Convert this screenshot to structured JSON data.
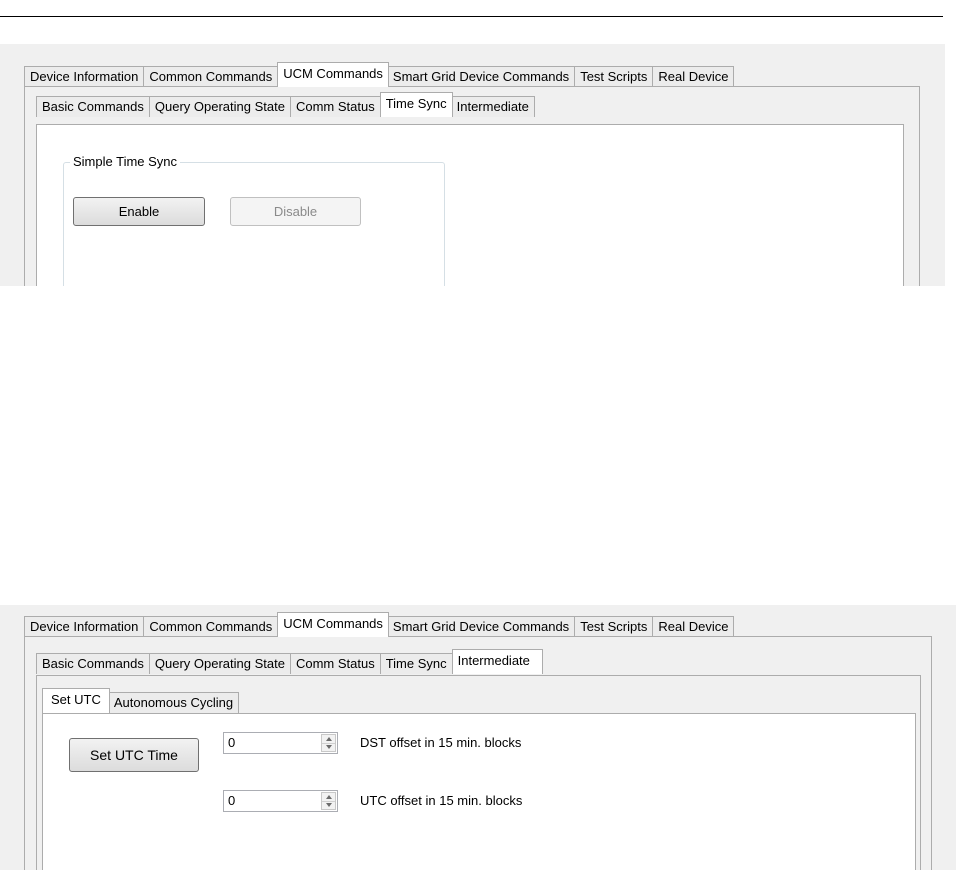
{
  "panel1": {
    "main_tabs": [
      "Device Information",
      "Common Commands",
      "UCM Commands",
      "Smart Grid Device Commands",
      "Test Scripts",
      "Real Device"
    ],
    "sub_tabs": [
      "Basic Commands",
      "Query Operating State",
      "Comm Status",
      "Time Sync",
      "Intermediate"
    ],
    "group_title": "Simple Time Sync",
    "enable_label": "Enable",
    "disable_label": "Disable"
  },
  "panel2": {
    "main_tabs": [
      "Device Information",
      "Common Commands",
      "UCM Commands",
      "Smart Grid Device Commands",
      "Test Scripts",
      "Real Device"
    ],
    "sub_tabs": [
      "Basic Commands",
      "Query Operating State",
      "Comm Status",
      "Time Sync",
      "Intermediate"
    ],
    "inner_tabs": [
      "Set UTC",
      "Autonomous Cycling"
    ],
    "set_utc_label": "Set UTC Time",
    "dst_value": "0",
    "dst_label": "DST offset in 15 min. blocks",
    "utc_value": "0",
    "utc_label": "UTC offset in 15 min. blocks"
  }
}
